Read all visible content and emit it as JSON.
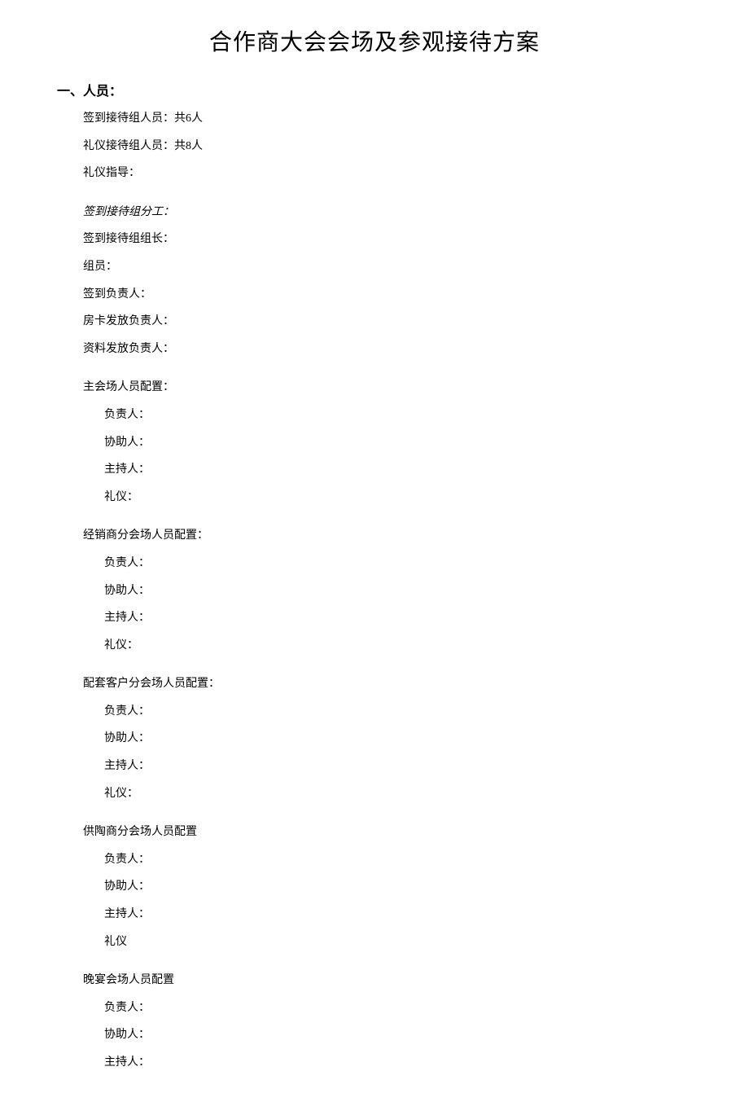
{
  "title": "合作商大会会场及参观接待方案",
  "section1_heading": "一、人员：",
  "checkin_staff": "签到接待组人员：共6人",
  "etiquette_staff": "礼仪接待组人员：共8人",
  "etiquette_guide": "礼仪指导：",
  "checkin_division_heading": "签到接待组分工：",
  "checkin_leader": "签到接待组组长：",
  "members": "组员：",
  "checkin_responsible": "签到负责人：",
  "roomcard_responsible": "房卡发放负责人：",
  "material_responsible": "资料发放负责人：",
  "main_venue_heading": "主会场人员配置：",
  "distributor_venue_heading": "经销商分会场人员配置：",
  "supporting_venue_heading": "配套客户分会场人员配置：",
  "ceramic_venue_heading": "供陶商分会场人员配置",
  "banquet_venue_heading": "晚宴会场人员配置",
  "role_responsible": "负责人：",
  "role_assistant": "协助人：",
  "role_host": "主持人：",
  "role_etiquette_colon": "礼仪：",
  "role_etiquette": "礼仪"
}
